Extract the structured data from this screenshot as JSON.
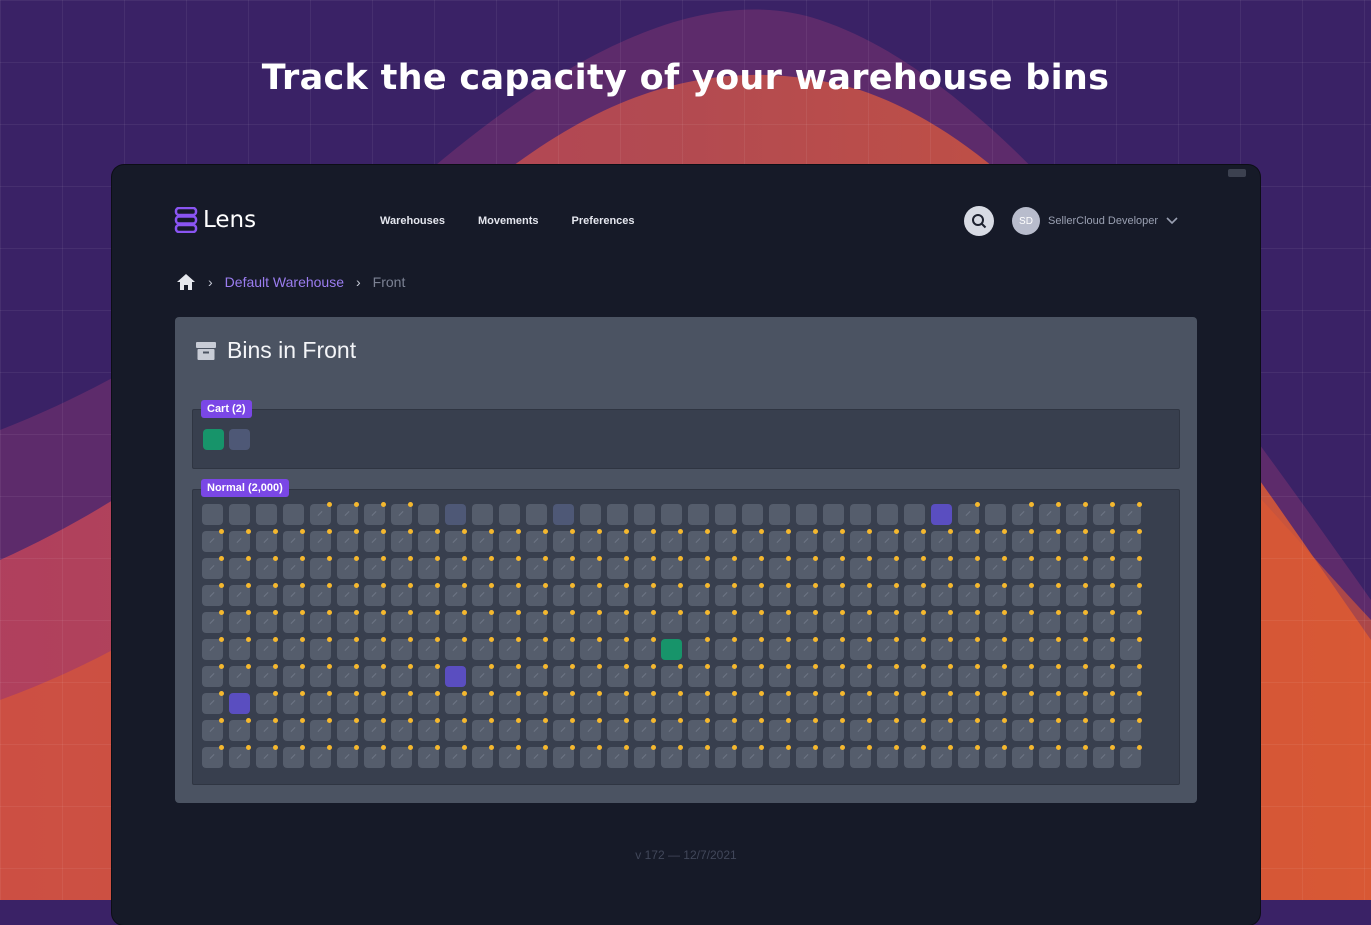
{
  "headline": "Track the capacity of your warehouse bins",
  "colors": {
    "accent": "#7a47e6",
    "bin_full": "#17946a",
    "bin_blue": "#5a4ec0",
    "capacity_dot": "#f5b82e"
  },
  "app": {
    "name": "Lens",
    "logo_icon": "database-stack-icon"
  },
  "nav": {
    "items": [
      "Warehouses",
      "Movements",
      "Preferences"
    ]
  },
  "user": {
    "initials": "SD",
    "name": "SellerCloud Developer"
  },
  "breadcrumb": {
    "home_icon": "home-icon",
    "warehouse": "Default Warehouse",
    "current": "Front"
  },
  "panel": {
    "title": "Bins in Front",
    "icon": "archive-box-icon"
  },
  "groups": {
    "cart": {
      "label": "Cart (2)",
      "bins": [
        "full",
        "slate"
      ]
    },
    "normal": {
      "label": "Normal (2,000)",
      "rows": 10,
      "cols": 35,
      "no_capacity_row0": [
        0,
        1,
        2,
        3,
        8,
        9,
        10,
        11,
        12,
        13,
        14,
        15,
        16,
        17,
        18,
        19,
        20,
        21,
        22,
        23,
        24,
        25,
        26,
        27,
        29
      ],
      "special": [
        {
          "row": 0,
          "col": 9,
          "state": "slate"
        },
        {
          "row": 0,
          "col": 13,
          "state": "slate"
        },
        {
          "row": 0,
          "col": 27,
          "state": "blue"
        },
        {
          "row": 5,
          "col": 17,
          "state": "full"
        },
        {
          "row": 6,
          "col": 9,
          "state": "blue"
        },
        {
          "row": 7,
          "col": 1,
          "state": "blue"
        }
      ]
    }
  },
  "footer": "v 172 — 12/7/2021"
}
